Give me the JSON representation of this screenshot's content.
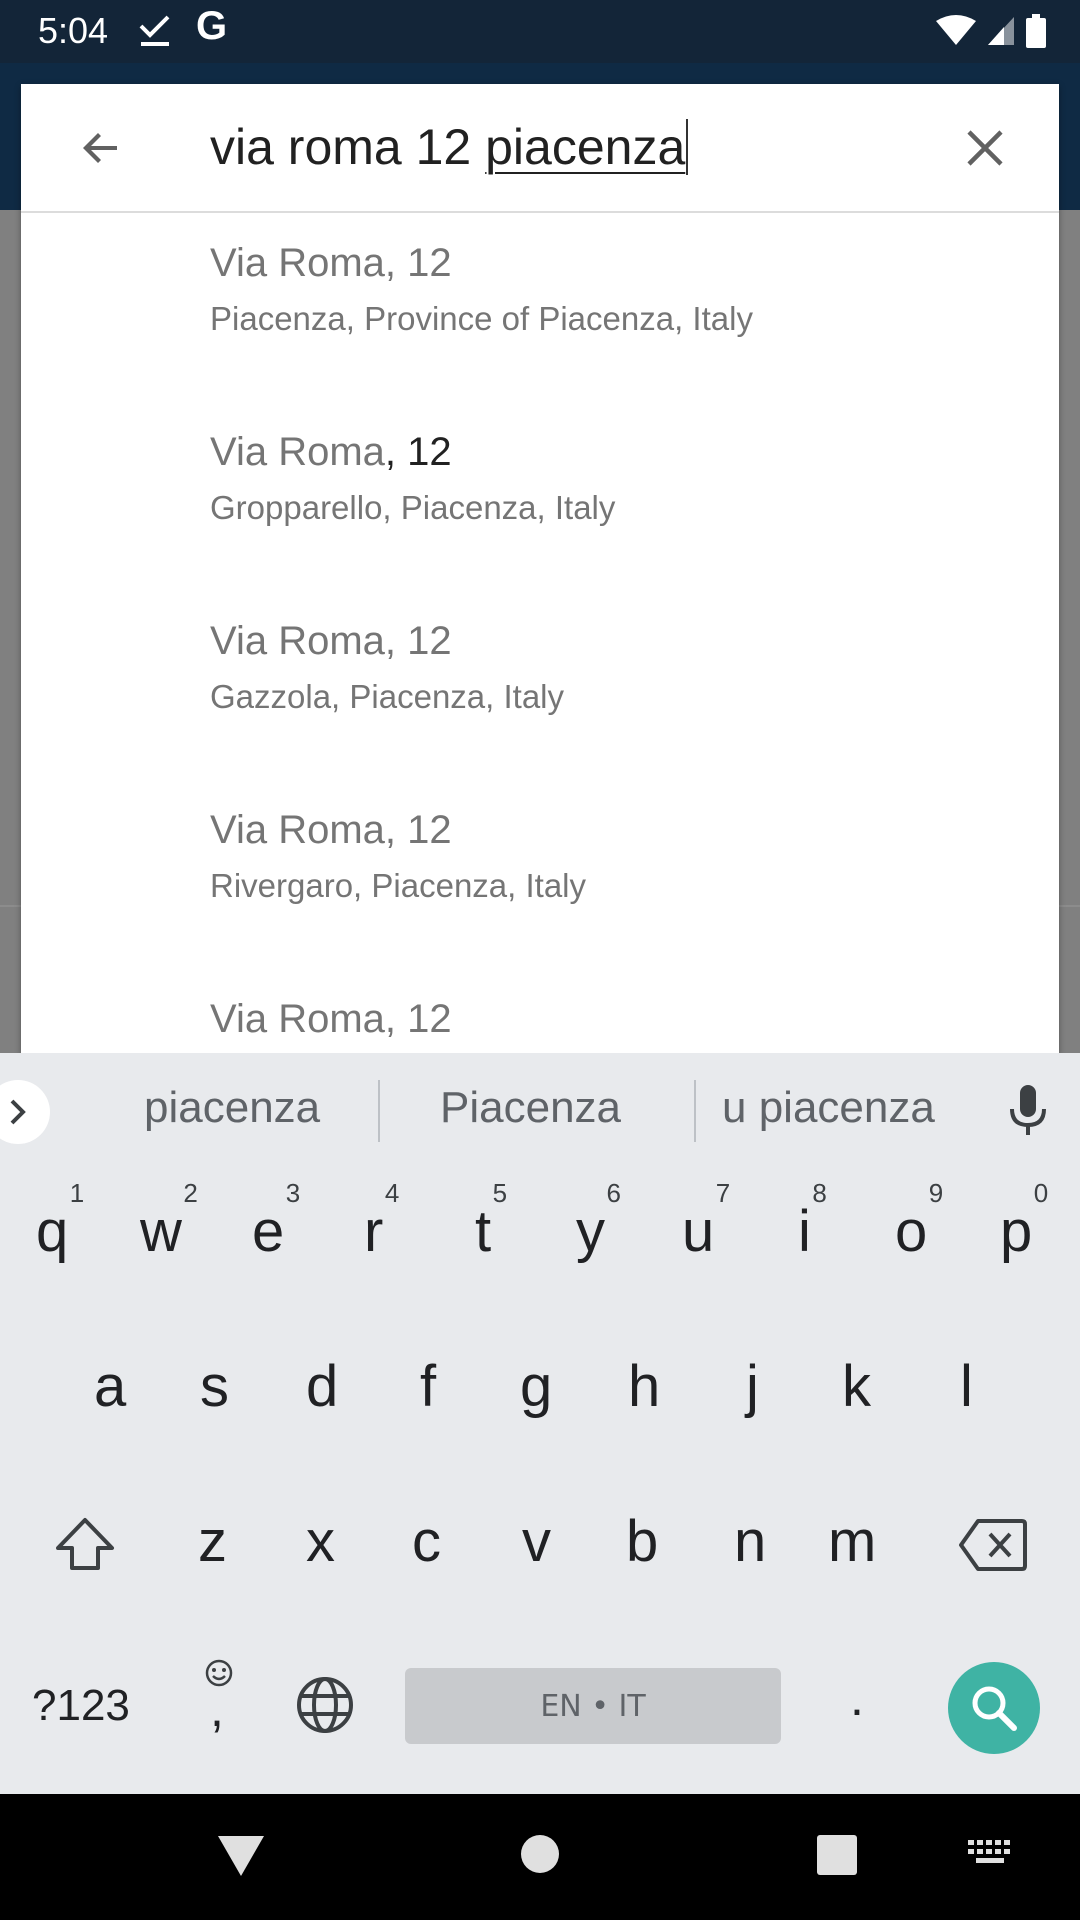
{
  "status_bar": {
    "time": "5:04",
    "g_label": "G"
  },
  "search": {
    "query_typed": "via roma 12 ",
    "query_composing": "piacenza"
  },
  "results": [
    {
      "title": "Via Roma",
      "number": ", 12",
      "subtitle": "Piacenza, Province of Piacenza, Italy"
    },
    {
      "title": "Via Roma",
      "number": ", 12",
      "subtitle": "Gropparello, Piacenza, Italy"
    },
    {
      "title": "Via Roma",
      "number": ", 12",
      "subtitle": "Gazzola, Piacenza, Italy"
    },
    {
      "title": "Via Roma",
      "number": ", 12",
      "subtitle": "Rivergaro, Piacenza, Italy"
    },
    {
      "title": "Via Roma",
      "number": ", 12",
      "subtitle": ""
    }
  ],
  "keyboard": {
    "suggestions": [
      "piacenza",
      "Piacenza",
      "u piacenza"
    ],
    "row1": [
      "q",
      "w",
      "e",
      "r",
      "t",
      "y",
      "u",
      "i",
      "o",
      "p"
    ],
    "row1_hints": [
      "1",
      "2",
      "3",
      "4",
      "5",
      "6",
      "7",
      "8",
      "9",
      "0"
    ],
    "row2": [
      "a",
      "s",
      "d",
      "f",
      "g",
      "h",
      "j",
      "k",
      "l"
    ],
    "row3": [
      "z",
      "x",
      "c",
      "v",
      "b",
      "n",
      "m"
    ],
    "symbols_label": "?123",
    "comma_label": ",",
    "space_label": "EN • IT",
    "period_label": "."
  },
  "colors": {
    "accent": "#3fb3a4",
    "statusbar": "#132538"
  }
}
